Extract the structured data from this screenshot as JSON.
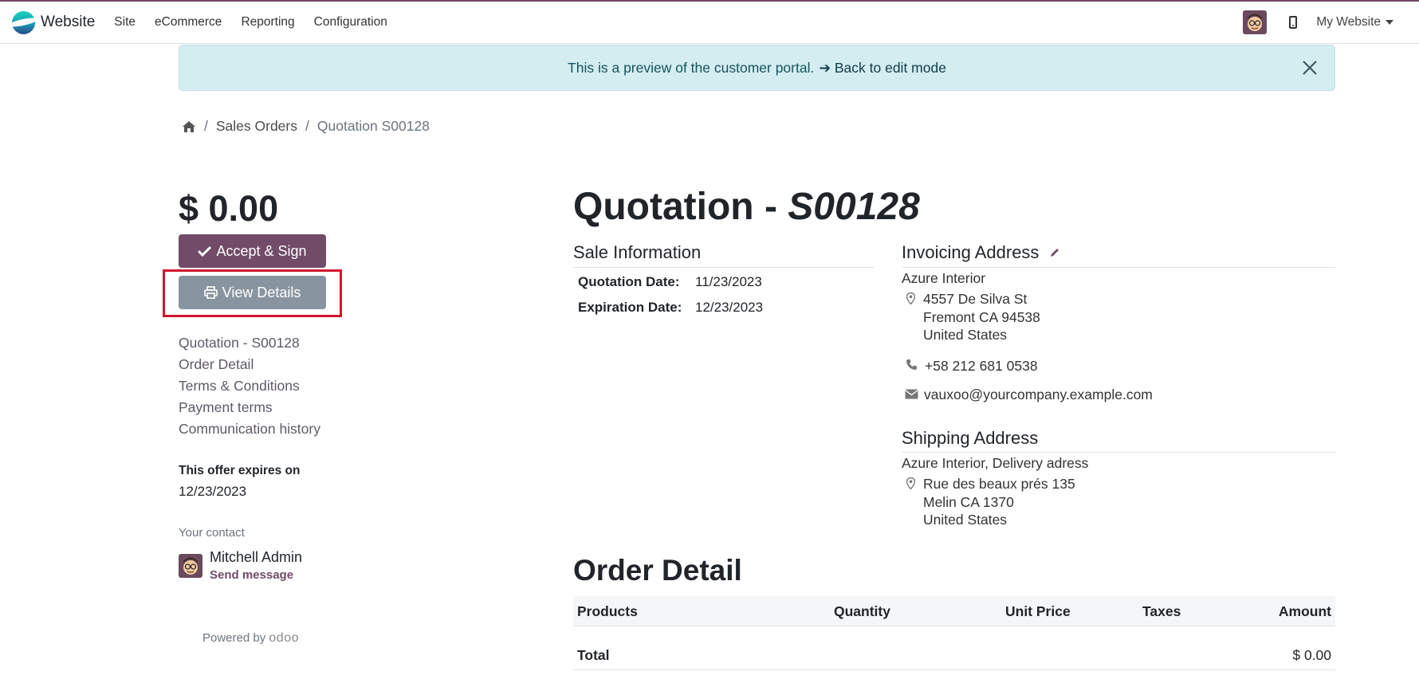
{
  "navbar": {
    "brand": "Website",
    "menu": [
      "Site",
      "eCommerce",
      "Reporting",
      "Configuration"
    ],
    "site_switch": "My Website"
  },
  "alert": {
    "text": "This is a preview of the customer portal.",
    "link": "➔ Back to edit mode"
  },
  "breadcrumb": {
    "sep": "/",
    "items": [
      "Sales Orders",
      "Quotation S00128"
    ]
  },
  "sidebar": {
    "price": "$ 0.00",
    "accept_button": "Accept & Sign",
    "view_button": "View Details",
    "nav": [
      "Quotation - S00128",
      "Order Detail",
      "Terms & Conditions",
      "Payment terms",
      "Communication history"
    ],
    "expires_label": "This offer expires on",
    "expires_date": "12/23/2023",
    "contact_label": "Your contact",
    "contact_name": "Mitchell Admin",
    "contact_action": "Send message",
    "powered_by": "Powered by",
    "powered_brand": "odoo"
  },
  "main": {
    "title_prefix": "Quotation - ",
    "title_ref": "S00128",
    "sale_info": {
      "heading": "Sale Information",
      "rows": [
        {
          "label": "Quotation Date:",
          "value": "11/23/2023"
        },
        {
          "label": "Expiration Date:",
          "value": "12/23/2023"
        }
      ]
    },
    "invoicing": {
      "heading": "Invoicing Address",
      "name": "Azure Interior",
      "street": "4557 De Silva St",
      "city": "Fremont CA 94538",
      "country": "United States",
      "phone": "+58 212 681 0538",
      "email": "vauxoo@yourcompany.example.com"
    },
    "shipping": {
      "heading": "Shipping Address",
      "name": "Azure Interior, Delivery adress",
      "street": "Rue des beaux prés 135",
      "city": "Melin CA 1370",
      "country": "United States"
    },
    "order_detail": {
      "heading": "Order Detail",
      "columns": [
        "Products",
        "Quantity",
        "Unit Price",
        "Taxes",
        "Amount"
      ],
      "total_label": "Total",
      "total_value": "$ 0.00"
    }
  },
  "colors": {
    "primary": "#714B67",
    "secondary_button": "#8895a0",
    "alert_bg": "#d3edf1",
    "highlight": "#d0162c"
  }
}
